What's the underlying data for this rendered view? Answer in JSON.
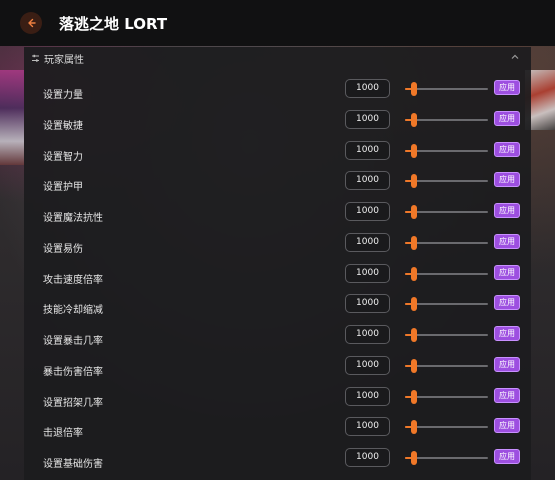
{
  "app": {
    "title": "落逃之地 LORT"
  },
  "section": {
    "title": "玩家属性"
  },
  "rows": [
    {
      "label": "设置力量",
      "value": "1000",
      "fill": 0.08,
      "apply": "应用"
    },
    {
      "label": "设置敏捷",
      "value": "1000",
      "fill": 0.08,
      "apply": "应用"
    },
    {
      "label": "设置智力",
      "value": "1000",
      "fill": 0.08,
      "apply": "应用"
    },
    {
      "label": "设置护甲",
      "value": "1000",
      "fill": 0.08,
      "apply": "应用"
    },
    {
      "label": "设置魔法抗性",
      "value": "1000",
      "fill": 0.08,
      "apply": "应用"
    },
    {
      "label": "设置易伤",
      "value": "1000",
      "fill": 0.08,
      "apply": "应用"
    },
    {
      "label": "攻击速度倍率",
      "value": "1000",
      "fill": 0.08,
      "apply": "应用"
    },
    {
      "label": "技能冷却缩减",
      "value": "1000",
      "fill": 0.08,
      "apply": "应用"
    },
    {
      "label": "设置暴击几率",
      "value": "1000",
      "fill": 0.08,
      "apply": "应用"
    },
    {
      "label": "暴击伤害倍率",
      "value": "1000",
      "fill": 0.08,
      "apply": "应用"
    },
    {
      "label": "设置招架几率",
      "value": "1000",
      "fill": 0.08,
      "apply": "应用"
    },
    {
      "label": "击退倍率",
      "value": "1000",
      "fill": 0.08,
      "apply": "应用"
    },
    {
      "label": "设置基础伤害",
      "value": "1000",
      "fill": 0.08,
      "apply": "应用"
    }
  ],
  "colors": {
    "accent": "#f07828",
    "apply_button": "#9d4fe0"
  },
  "icons": {
    "back": "back-arrow-icon",
    "section": "sliders-icon",
    "collapse": "chevron-up-icon"
  }
}
